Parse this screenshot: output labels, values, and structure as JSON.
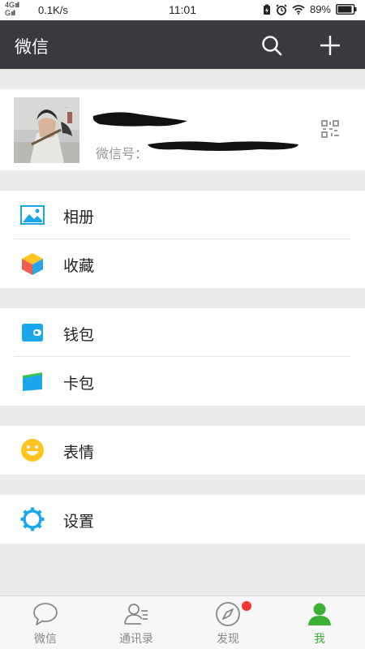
{
  "status_bar": {
    "network_top": "4G",
    "network_bottom": "G",
    "speed": "0.1K/s",
    "time": "11:01",
    "battery": "89%"
  },
  "nav": {
    "title": "微信",
    "search_icon": "search-icon",
    "add_icon": "plus-icon"
  },
  "profile": {
    "wechat_id_label": "微信号：",
    "qr_icon": "qr-code-icon"
  },
  "menu": {
    "album": "相册",
    "favorites": "收藏",
    "wallet": "钱包",
    "cards": "卡包",
    "stickers": "表情",
    "settings": "设置"
  },
  "tabs": [
    {
      "label": "微信",
      "icon": "chat-bubble-icon",
      "active": false
    },
    {
      "label": "通讯录",
      "icon": "contacts-icon",
      "active": false
    },
    {
      "label": "发现",
      "icon": "compass-icon",
      "active": false,
      "badge": true
    },
    {
      "label": "我",
      "icon": "person-icon",
      "active": true
    }
  ],
  "colors": {
    "nav_bg": "#393a3f",
    "accent_green": "#3cb034",
    "badge_red": "#f43530",
    "icon_blue": "#1aa7ec"
  }
}
